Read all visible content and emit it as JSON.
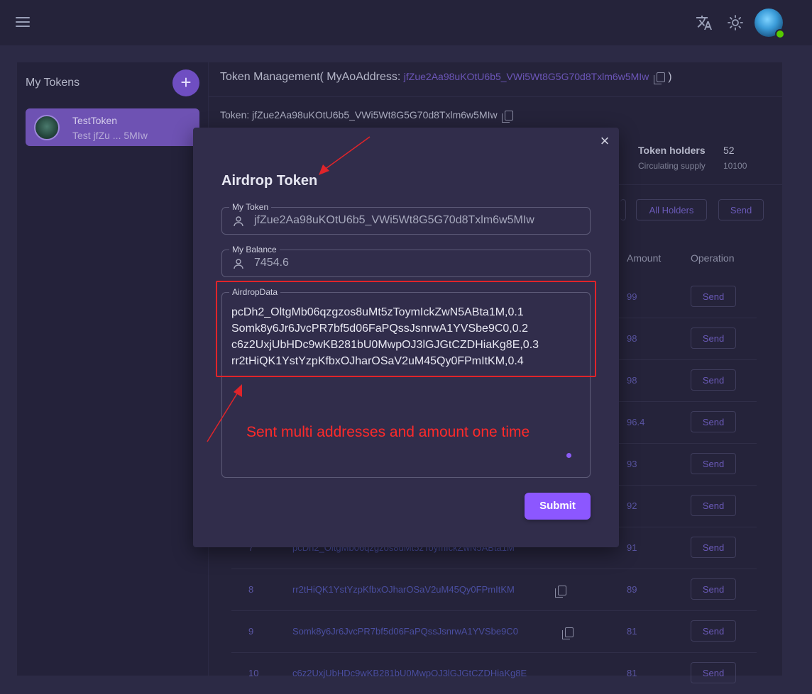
{
  "topbar": {
    "icons": [
      "menu-icon",
      "translate-icon",
      "sun-icon",
      "avatar"
    ]
  },
  "sidebar": {
    "title": "My Tokens",
    "add_label": "+",
    "tokens": [
      {
        "name": "TestToken",
        "subtitle": "Test jfZu ... 5MIw"
      }
    ]
  },
  "main": {
    "header_prefix": "Token Management( MyAoAddress:",
    "header_address": "jfZue2Aa98uKOtU6b5_VWi5Wt8G5G70d8Txlm6w5MIw",
    "header_suffix": ")",
    "token_line": "Token: jfZue2Aa98uKOtU6b5_VWi5Wt8G5G70d8Txlm6w5MIw",
    "stats": {
      "holders_label": "Token holders",
      "holders_value": "52",
      "supply_label": "Circulating supply",
      "supply_value": "10100"
    },
    "buttons": {
      "all_holders": "All Holders",
      "send": "Send"
    },
    "columns": {
      "amount": "Amount",
      "operation": "Operation"
    },
    "rows": [
      {
        "index": "",
        "address": "",
        "amount": "99",
        "send": "Send"
      },
      {
        "index": "",
        "address": "",
        "amount": "98",
        "send": "Send"
      },
      {
        "index": "",
        "address": "",
        "amount": "98",
        "send": "Send"
      },
      {
        "index": "",
        "address": "",
        "amount": "96.4",
        "send": "Send"
      },
      {
        "index": "",
        "address": "",
        "amount": "93",
        "send": "Send"
      },
      {
        "index": "",
        "address": "",
        "amount": "92",
        "send": "Send"
      },
      {
        "index": "7",
        "address": "pcDh2_OltgMb06qzgzos8uMt5zToymIckZwN5ABta1M",
        "amount": "91",
        "send": "Send"
      },
      {
        "index": "8",
        "address": "rr2tHiQK1YstYzpKfbxOJharOSaV2uM45Qy0FPmItKM",
        "amount": "89",
        "send": "Send"
      },
      {
        "index": "9",
        "address": "Somk8y6Jr6JvcPR7bf5d06FaPQssJsnrwA1YVSbe9C0",
        "amount": "81",
        "send": "Send"
      },
      {
        "index": "10",
        "address": "c6z2UxjUbHDc9wKB281bU0MwpOJ3lGJGtCZDHiaKg8E",
        "amount": "81",
        "send": "Send"
      }
    ]
  },
  "dialog": {
    "title": "Airdrop Token",
    "close_label": "×",
    "my_token_label": "My Token",
    "my_token_value": "jfZue2Aa98uKOtU6b5_VWi5Wt8G5G70d8Txlm6w5MIw",
    "my_balance_label": "My Balance",
    "my_balance_value": "7454.6",
    "airdrop_label": "AirdropData",
    "airdrop_value": "pcDh2_OltgMb06qzgzos8uMt5zToymIckZwN5ABta1M,0.1\nSomk8y6Jr6JvcPR7bf5d06FaPQssJsnrwA1YVSbe9C0,0.2\nc6z2UxjUbHDc9wKB281bU0MwpOJ3lGJGtCZDHiaKg8E,0.3\nrr2tHiQK1YstYzpKfbxOJharOSaV2uM45Qy0FPmItKM,0.4",
    "submit_label": "Submit"
  },
  "annotation": {
    "text": "Sent multi addresses and amount one time",
    "color": "#ff2a2a"
  }
}
